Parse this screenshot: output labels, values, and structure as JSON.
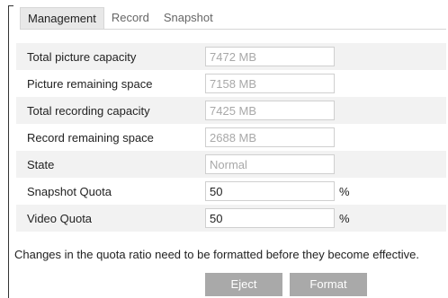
{
  "tabs": [
    {
      "label": "Management",
      "active": true
    },
    {
      "label": "Record",
      "active": false
    },
    {
      "label": "Snapshot",
      "active": false
    }
  ],
  "rows": [
    {
      "label": "Total picture capacity",
      "value": "7472 MB"
    },
    {
      "label": "Picture remaining space",
      "value": "7158 MB"
    },
    {
      "label": "Total recording capacity",
      "value": "7425 MB"
    },
    {
      "label": "Record remaining space",
      "value": "2688 MB"
    },
    {
      "label": "State",
      "value": "Normal"
    },
    {
      "label": "Snapshot Quota",
      "value": "50",
      "unit": "%"
    },
    {
      "label": "Video Quota",
      "value": "50",
      "unit": "%"
    }
  ],
  "note": "Changes in the quota ratio need to be formatted before they become effective.",
  "buttons": {
    "eject": "Eject",
    "format": "Format"
  },
  "colors": {
    "button_bg": "#a9a9a9",
    "tab_active_bg": "#e8e8e8",
    "row_shade": "#f2f2f2",
    "readonly_text": "#a8a8a8"
  }
}
